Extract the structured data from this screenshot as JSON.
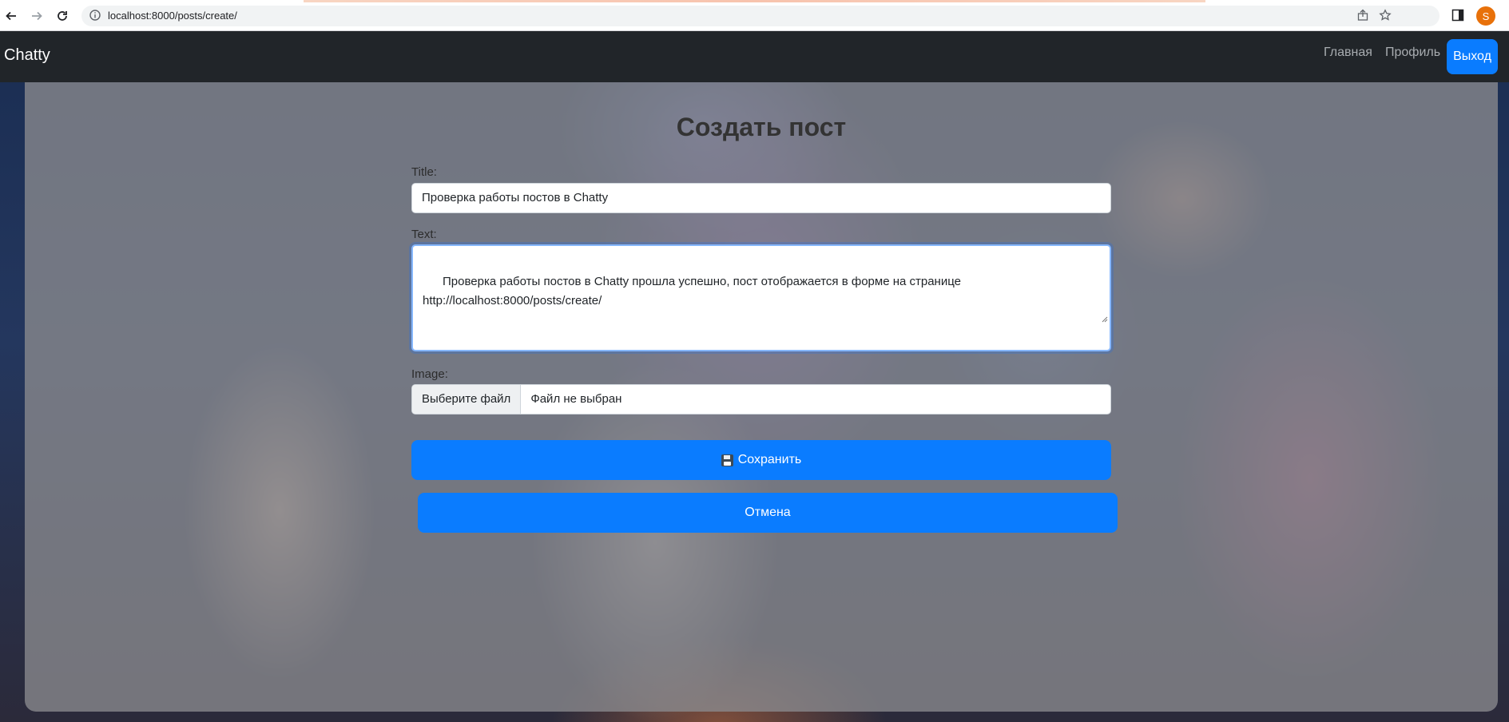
{
  "browser": {
    "url": "localhost:8000/posts/create/",
    "profile_initial": "S"
  },
  "navbar": {
    "brand": "Chatty",
    "links": [
      "Главная",
      "Профиль"
    ],
    "logout_label": "Выход"
  },
  "page": {
    "title": "Создать пост"
  },
  "form": {
    "title_label": "Title:",
    "title_value": "Проверка работы постов в Chatty",
    "text_label": "Text:",
    "text_value": "Проверка работы постов в Chatty прошла успешно, пост отображается в форме на странице\nhttp://localhost:8000/posts/create/",
    "image_label": "Image:",
    "file_button": "Выберите файл",
    "file_status": "Файл не выбран",
    "save_label": "Сохранить",
    "cancel_label": "Отмена"
  },
  "colors": {
    "navbar_bg": "#212529",
    "primary": "#0a7cff",
    "avatar": "#e8710a"
  }
}
